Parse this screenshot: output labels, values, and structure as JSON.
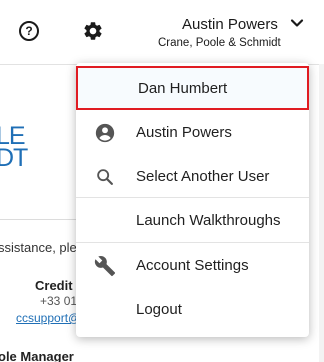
{
  "header": {
    "help_icon_glyph": "?",
    "user_name": "Austin Powers",
    "company": "Crane, Poole & Schmidt"
  },
  "background": {
    "logo_lines": [
      "LE",
      "DT"
    ],
    "assistance_text": "ssistance, plea",
    "credit_label": "Credit C",
    "phone": "+33 01",
    "email": "ccsupport@",
    "role": "ole Manager"
  },
  "user_dropdown": {
    "items": [
      {
        "label": "Dan Humbert",
        "icon": "none",
        "selected": true
      },
      {
        "label": "Austin Powers",
        "icon": "account-circle-icon"
      },
      {
        "label": "Select Another User",
        "icon": "search-icon"
      },
      {
        "label": "Launch Walkthroughs",
        "icon": "none"
      },
      {
        "label": "Account Settings",
        "icon": "wrench-icon"
      },
      {
        "label": "Logout",
        "icon": "none"
      }
    ]
  },
  "colors": {
    "selected_border": "#e01b22",
    "link_blue": "#1f6fb6"
  }
}
